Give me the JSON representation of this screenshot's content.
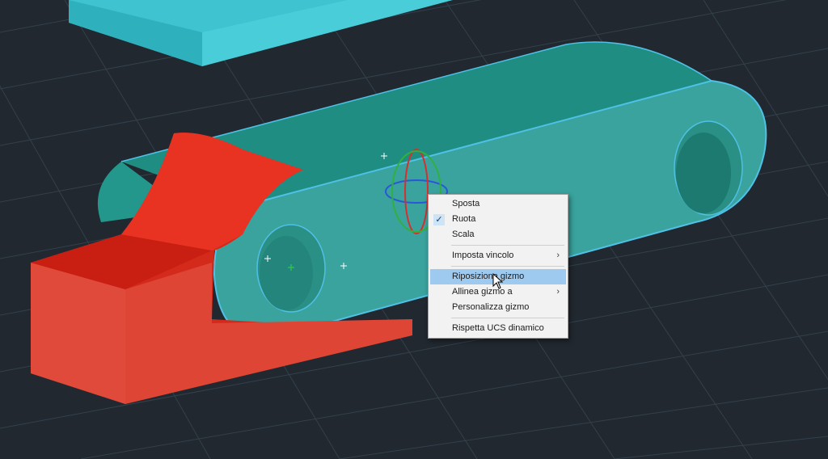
{
  "context_menu": {
    "items": [
      {
        "label": "Sposta",
        "checked": false,
        "submenu": false
      },
      {
        "label": "Ruota",
        "checked": true,
        "submenu": false
      },
      {
        "label": "Scala",
        "checked": false,
        "submenu": false
      },
      {
        "label": "Imposta vincolo",
        "checked": false,
        "submenu": true
      },
      {
        "label": "Riposiziona gizmo",
        "checked": false,
        "submenu": false,
        "highlighted": true
      },
      {
        "label": "Allinea gizmo a",
        "checked": false,
        "submenu": true
      },
      {
        "label": "Personalizza gizmo",
        "checked": false,
        "submenu": false
      },
      {
        "label": "Rispetta UCS dinamico",
        "checked": false,
        "submenu": false
      }
    ],
    "check_glyph": "✓",
    "submenu_glyph": "›"
  },
  "colors": {
    "background": "#212830",
    "grid": "#34404c",
    "link_body": "#3aa39d",
    "link_top": "#1e8a80",
    "link_edge": "#4fc0e6",
    "bracket_red": "#e03020",
    "block_cyan": "#3fc3d0",
    "menu_highlight": "#9fcaf0"
  },
  "icons": [
    "rotate-gizmo-icon",
    "mouse-pointer-icon",
    "crosshair-marker-icon"
  ]
}
